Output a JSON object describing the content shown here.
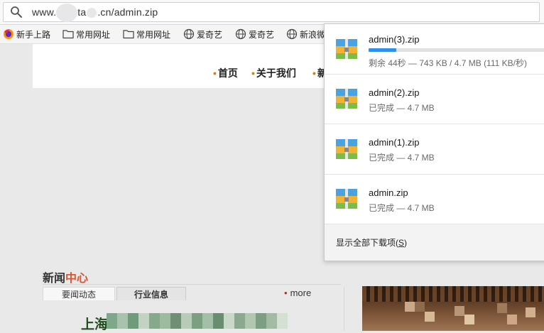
{
  "browser": {
    "url": {
      "part1": "www.",
      "part2": "ta",
      "part3": ".cn/admin.zip"
    }
  },
  "bookmarks": [
    {
      "label": "新手上路",
      "icon": "firefox-icon"
    },
    {
      "label": "常用网址",
      "icon": "folder-icon"
    },
    {
      "label": "常用网址",
      "icon": "folder-icon"
    },
    {
      "label": "爱奇艺",
      "icon": "globe-icon"
    },
    {
      "label": "爱奇艺",
      "icon": "globe-icon"
    },
    {
      "label": "新浪微",
      "icon": "globe-icon"
    }
  ],
  "page": {
    "nav": [
      "首页",
      "关于我们",
      "新"
    ],
    "news": {
      "title_main": "新闻",
      "title_accent": "中心",
      "tabs": [
        "要闻动态",
        "行业信息"
      ],
      "more": "more",
      "headline": "上海"
    },
    "colors": {
      "accent": "#e57b00",
      "news_accent": "#d9542f"
    }
  },
  "downloads": {
    "items": [
      {
        "name": "admin(3).zip",
        "status": "剩余 44秒 — 743 KB / 4.7 MB (111 KB/秒)",
        "progress_percent": 15.4,
        "in_progress": true
      },
      {
        "name": "admin(2).zip",
        "status": "已完成 — 4.7 MB",
        "in_progress": false
      },
      {
        "name": "admin(1).zip",
        "status": "已完成 — 4.7 MB",
        "in_progress": false
      },
      {
        "name": "admin.zip",
        "status": "已完成 — 4.7 MB",
        "in_progress": false
      }
    ],
    "footer": {
      "label_prefix": "显示全部下载项(",
      "label_key": "S",
      "label_suffix": ")"
    },
    "colors": {
      "progress": "#2f8ff0"
    }
  }
}
